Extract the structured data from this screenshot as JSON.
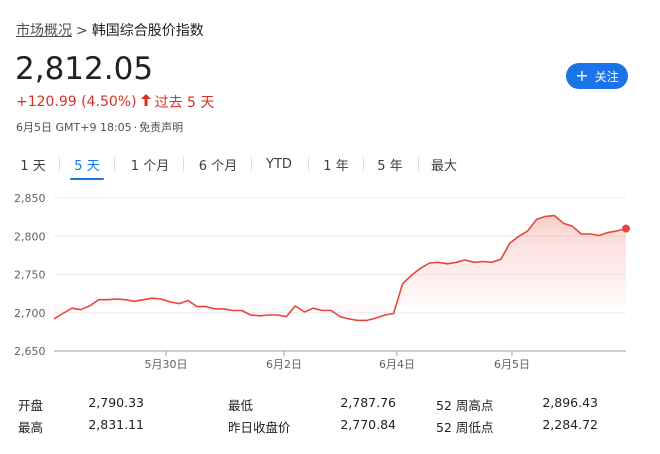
{
  "breadcrumb": {
    "parent": "市场概况",
    "separator": ">",
    "current": "韩国综合股价指数"
  },
  "quote": {
    "price": "2,812.05",
    "change": "+120.99 (4.50%)",
    "period": "过去 5 天",
    "timestamp": "6月5日 GMT+9 18:05",
    "disclaimer": "免责声明"
  },
  "follow_button": {
    "label": "关注"
  },
  "tabs": [
    {
      "label": "1 天",
      "active": false
    },
    {
      "label": "5 天",
      "active": true
    },
    {
      "label": "1 个月",
      "active": false
    },
    {
      "label": "6 个月",
      "active": false
    },
    {
      "label": "YTD",
      "active": false
    },
    {
      "label": "1 年",
      "active": false
    },
    {
      "label": "5 年",
      "active": false
    },
    {
      "label": "最大",
      "active": false
    }
  ],
  "colors": {
    "line": "#e8453c",
    "fill_top": "#f8c9c5",
    "accent": "#1a73e8",
    "negative_text": "#d93025"
  },
  "chart_data": {
    "type": "area",
    "ylim": [
      2650,
      2850
    ],
    "yticks": [
      2650,
      2700,
      2750,
      2800,
      2850
    ],
    "ytick_labels": [
      "2,650",
      "2,700",
      "2,750",
      "2,800",
      "2,850"
    ],
    "xtick_labels": [
      "5月30日",
      "6月2日",
      "6月4日",
      "6月5日"
    ],
    "xtick_positions": [
      12,
      22,
      32,
      42
    ],
    "grid": true,
    "x": [
      0,
      1,
      2,
      3,
      4,
      5,
      6,
      7,
      8,
      9,
      10,
      11,
      12,
      13,
      14,
      15,
      16,
      17,
      18,
      19,
      20,
      21,
      22,
      23,
      24,
      25,
      26,
      27,
      28,
      29,
      30,
      31,
      32,
      33,
      34,
      35,
      36,
      37,
      38,
      39,
      40,
      41,
      42,
      43,
      44,
      45,
      46,
      47,
      48,
      49,
      50
    ],
    "y": [
      2692,
      2699,
      2706,
      2704,
      2709,
      2717,
      2717,
      2718,
      2717,
      2715,
      2717,
      2719,
      2718,
      2714,
      2712,
      2716,
      2708,
      2708,
      2705,
      2705,
      2703,
      2703,
      2697,
      2696,
      2697,
      2697,
      2695,
      2709,
      2701,
      2706,
      2703,
      2703,
      2695,
      2692,
      2690,
      2690,
      2693,
      2697,
      2699,
      2738,
      2749,
      2758,
      2765,
      2766,
      2764,
      2766,
      2769,
      2766,
      2767,
      2766,
      2770,
      2791,
      2800,
      2807,
      2822,
      2826,
      2827,
      2817,
      2813,
      2803,
      2803,
      2801,
      2805,
      2807,
      2810
    ],
    "last_value": 2810
  },
  "stats": [
    {
      "label": "开盘",
      "value": "2,790.33"
    },
    {
      "label": "最高",
      "value": "2,831.11"
    },
    {
      "label": "最低",
      "value": "2,787.76"
    },
    {
      "label": "昨日收盘价",
      "value": "2,770.84"
    },
    {
      "label": "52 周高点",
      "value": "2,896.43"
    },
    {
      "label": "52 周低点",
      "value": "2,284.72"
    }
  ]
}
